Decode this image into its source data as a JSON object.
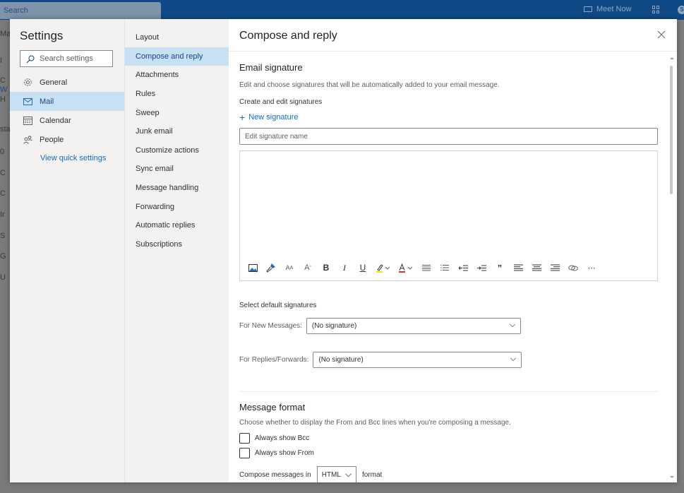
{
  "app": {
    "search_placeholder": "Search",
    "meet_now_label": "Meet Now",
    "skype_badge": "S",
    "background_fragments": [
      "Ma",
      "I",
      "C",
      "W",
      "H",
      "sta",
      "0",
      "C",
      "C",
      "Ir",
      "S",
      "G",
      "U"
    ]
  },
  "settings": {
    "title": "Settings",
    "search_placeholder": "Search settings",
    "categories": [
      {
        "label": "General",
        "icon": "gear-icon",
        "active": false
      },
      {
        "label": "Mail",
        "icon": "mail-icon",
        "active": true
      },
      {
        "label": "Calendar",
        "icon": "calendar-icon",
        "active": false
      },
      {
        "label": "People",
        "icon": "people-icon",
        "active": false
      }
    ],
    "quick_settings_link": "View quick settings",
    "mail_sections": [
      {
        "label": "Layout",
        "active": false
      },
      {
        "label": "Compose and reply",
        "active": true
      },
      {
        "label": "Attachments",
        "active": false
      },
      {
        "label": "Rules",
        "active": false
      },
      {
        "label": "Sweep",
        "active": false
      },
      {
        "label": "Junk email",
        "active": false
      },
      {
        "label": "Customize actions",
        "active": false
      },
      {
        "label": "Sync email",
        "active": false
      },
      {
        "label": "Message handling",
        "active": false
      },
      {
        "label": "Forwarding",
        "active": false
      },
      {
        "label": "Automatic replies",
        "active": false
      },
      {
        "label": "Subscriptions",
        "active": false
      }
    ]
  },
  "page": {
    "title": "Compose and reply",
    "email_signature": {
      "title": "Email signature",
      "description": "Edit and choose signatures that will be automatically added to your email message.",
      "create_label": "Create and edit signatures",
      "new_signature": "New signature",
      "name_placeholder": "Edit signature name",
      "name_value": "",
      "body_value": "",
      "toolbar": [
        "insert-picture-icon",
        "format-painter-icon",
        "font-size-icon",
        "superscript-icon",
        "bold-icon",
        "italic-icon",
        "underline-icon",
        "highlight-icon",
        "font-color-icon",
        "bullets-icon",
        "numbering-icon",
        "decrease-indent-icon",
        "increase-indent-icon",
        "quote-icon",
        "align-left-icon",
        "align-center-icon",
        "align-right-icon",
        "link-icon",
        "more-icon"
      ],
      "highlight_color": "#f2e600",
      "font_color": "#d13438"
    },
    "default_signatures": {
      "title": "Select default signatures",
      "new_messages_label": "For New Messages:",
      "new_messages_value": "(No signature)",
      "replies_label": "For Replies/Forwards:",
      "replies_value": "(No signature)"
    },
    "message_format": {
      "title": "Message format",
      "description": "Choose whether to display the From and Bcc lines when you're composing a message.",
      "always_bcc": {
        "label": "Always show Bcc",
        "checked": false
      },
      "always_from": {
        "label": "Always show From",
        "checked": false
      },
      "compose_prefix": "Compose messages in",
      "compose_value": "HTML",
      "compose_suffix": "format"
    }
  },
  "colors": {
    "accent": "#106ebe",
    "selected_bg": "#c7e0f4",
    "topbar": "#0f4a86"
  }
}
